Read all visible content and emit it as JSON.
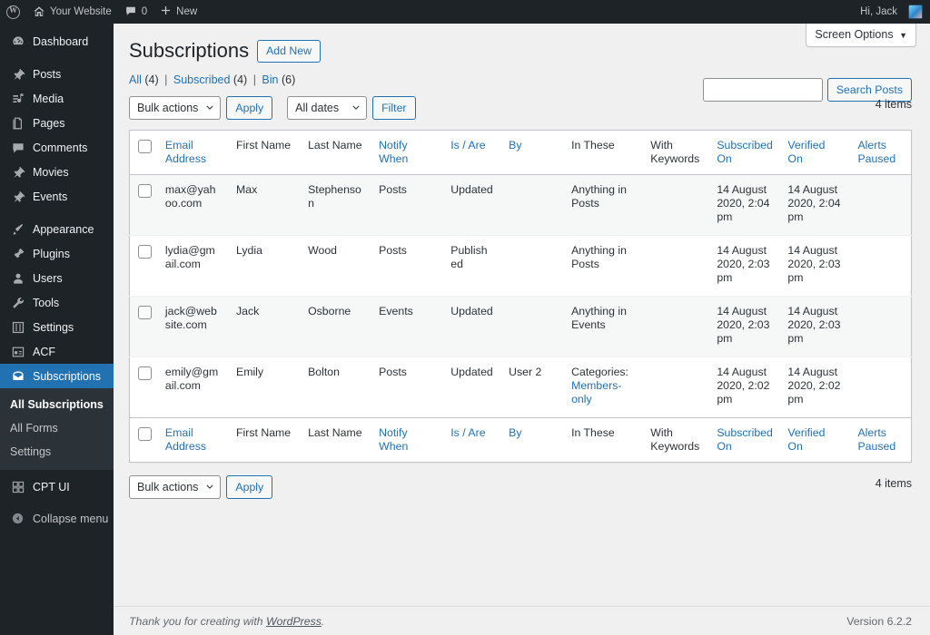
{
  "adminbar": {
    "logo_icon": "wordpress-logo-icon",
    "site_icon": "home-icon",
    "site_name": "Your Website",
    "comments_icon": "comment-bubble-icon",
    "comments_count": "0",
    "new_icon": "plus-icon",
    "new_label": "New",
    "greeting": "Hi, Jack",
    "avatar_icon": "user-avatar"
  },
  "sidebar": {
    "items": [
      {
        "label": "Dashboard",
        "icon": "dashboard-icon"
      },
      {
        "label": "Posts",
        "icon": "pin-icon"
      },
      {
        "label": "Media",
        "icon": "media-icon"
      },
      {
        "label": "Pages",
        "icon": "pages-icon"
      },
      {
        "label": "Comments",
        "icon": "comment-bubble-icon"
      },
      {
        "label": "Movies",
        "icon": "pin-icon"
      },
      {
        "label": "Events",
        "icon": "pin-icon"
      },
      {
        "label": "Appearance",
        "icon": "brush-icon"
      },
      {
        "label": "Plugins",
        "icon": "plug-icon"
      },
      {
        "label": "Users",
        "icon": "user-icon"
      },
      {
        "label": "Tools",
        "icon": "wrench-icon"
      },
      {
        "label": "Settings",
        "icon": "settings-sliders-icon"
      },
      {
        "label": "ACF",
        "icon": "acf-icon"
      },
      {
        "label": "Subscriptions",
        "icon": "envelope-icon"
      },
      {
        "label": "CPT UI",
        "icon": "cpt-ui-icon"
      }
    ],
    "submenu": [
      {
        "label": "All Subscriptions"
      },
      {
        "label": "All Forms"
      },
      {
        "label": "Settings"
      }
    ],
    "collapse": {
      "label": "Collapse menu",
      "icon": "collapse-arrow-icon"
    },
    "current_accent": "#2271b1"
  },
  "screen_options": {
    "label": "Screen Options",
    "chevron": "▼"
  },
  "header": {
    "title": "Subscriptions",
    "add_new": "Add New"
  },
  "views": [
    {
      "label": "All",
      "count": "(4)"
    },
    {
      "label": "Subscribed",
      "count": "(4)"
    },
    {
      "label": "Bin",
      "count": "(6)"
    }
  ],
  "search": {
    "value": "",
    "placeholder": "",
    "button": "Search Posts"
  },
  "tablenav_top": {
    "bulk_actions": "Bulk actions",
    "apply": "Apply",
    "dates": "All dates",
    "filter": "Filter",
    "items": "4 items"
  },
  "tablenav_bottom": {
    "bulk_actions": "Bulk actions",
    "apply": "Apply",
    "items": "4 items"
  },
  "table": {
    "columns": [
      {
        "label": "Email Address",
        "link": true
      },
      {
        "label": "First Name",
        "link": false
      },
      {
        "label": "Last Name",
        "link": false
      },
      {
        "label": "Notify When",
        "link": true
      },
      {
        "label": "Is / Are",
        "link": true
      },
      {
        "label": "By",
        "link": true
      },
      {
        "label": "In These",
        "link": false
      },
      {
        "label": "With Keywords",
        "link": false
      },
      {
        "label": "Subscribed On",
        "link": true
      },
      {
        "label": "Verified On",
        "link": true
      },
      {
        "label": "Alerts Paused",
        "link": true
      }
    ],
    "rows": [
      {
        "email": "max@yahoo.com",
        "first_name": "Max",
        "last_name": "Stephenson",
        "notify_when": "Posts",
        "is_are": "Updated",
        "by": "",
        "in_these": "Anything in Posts",
        "in_these_link": "",
        "with_keywords": "",
        "subscribed_on": "14 August 2020, 2:04 pm",
        "verified_on": "14 August 2020, 2:04 pm",
        "alerts_paused": ""
      },
      {
        "email": "lydia@gmail.com",
        "first_name": "Lydia",
        "last_name": "Wood",
        "notify_when": "Posts",
        "is_are": "Published",
        "by": "",
        "in_these": "Anything in Posts",
        "in_these_link": "",
        "with_keywords": "",
        "subscribed_on": "14 August 2020, 2:03 pm",
        "verified_on": "14 August 2020, 2:03 pm",
        "alerts_paused": ""
      },
      {
        "email": "jack@website.com",
        "first_name": "Jack",
        "last_name": "Osborne",
        "notify_when": "Events",
        "is_are": "Updated",
        "by": "",
        "in_these": "Anything in Events",
        "in_these_link": "",
        "with_keywords": "",
        "subscribed_on": "14 August 2020, 2:03 pm",
        "verified_on": "14 August 2020, 2:03 pm",
        "alerts_paused": ""
      },
      {
        "email": "emily@gmail.com",
        "first_name": "Emily",
        "last_name": "Bolton",
        "notify_when": "Posts",
        "is_are": "Updated",
        "by": "User 2",
        "in_these": "Categories:",
        "in_these_link": "Members-only",
        "with_keywords": "",
        "subscribed_on": "14 August 2020, 2:02 pm",
        "verified_on": "14 August 2020, 2:02 pm",
        "alerts_paused": ""
      }
    ]
  },
  "footer": {
    "thanks_prefix": "Thank you for creating with ",
    "thanks_link": "WordPress",
    "thanks_suffix": ".",
    "version": "Version 6.2.2"
  }
}
